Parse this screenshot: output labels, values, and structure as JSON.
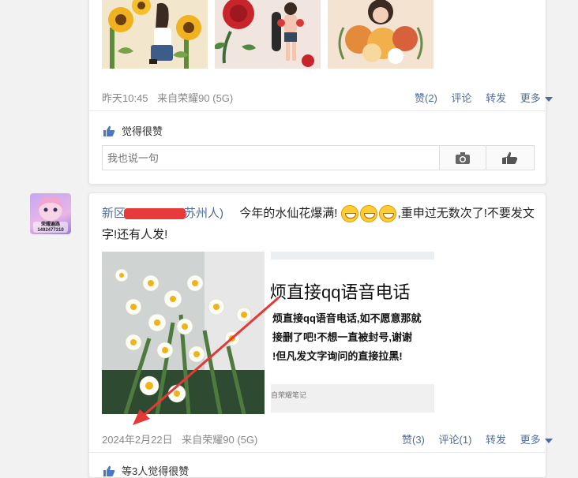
{
  "post1": {
    "time": "昨天10:45",
    "source": "来自荣耀90 (5G)",
    "actions": {
      "like": "赞(2)",
      "comment": "评论",
      "repost": "转发",
      "more": "更多"
    },
    "like_text": "觉得很赞",
    "comment_placeholder": "我也说一句"
  },
  "post2": {
    "username": "新区",
    "username_suffix": "苏州人)",
    "text_part1": "今年的水仙花爆满!",
    "text_part2": ",重申过无数次了!不要发文字!还有人发!",
    "time": "2024年2月22日",
    "source": "来自荣耀90 (5G)",
    "actions": {
      "like": "赞(3)",
      "comment": "评论(1)",
      "repost": "转发",
      "more": "更多"
    },
    "like_text": "等3人觉得很赞",
    "avatar_name": "荣耀遍路",
    "avatar_id": "1492477310",
    "screenshot": {
      "title": "烦直接qq语音电话",
      "line1": "烦直接qq语音电话,如不愿意那就",
      "line2": "接删了吧!不想一直被封号,谢谢",
      "line3": "!但凡发文字询问的直接拉黑!",
      "footer": "自荣耀笔记"
    }
  },
  "colors": {
    "link": "#506c9c",
    "annotation_arrow": "#e53935"
  }
}
